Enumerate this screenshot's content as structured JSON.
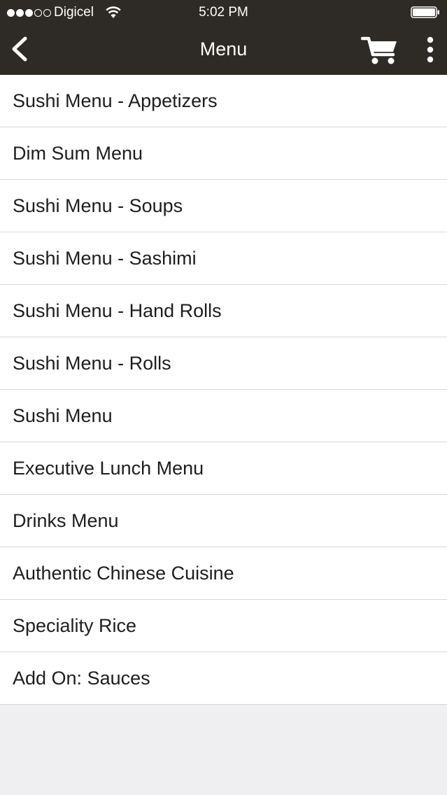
{
  "status_bar": {
    "carrier": "Digicel",
    "time": "5:02 PM",
    "signal_bars_filled": 3,
    "signal_bars_total": 5
  },
  "nav_bar": {
    "title": "Menu",
    "back_icon": "chevron-left-icon",
    "cart_icon": "cart-icon",
    "more_icon": "more-vertical-icon"
  },
  "colors": {
    "nav_background": "#2e2b26",
    "list_background": "#ffffff",
    "page_background": "#efeff1",
    "separator": "#d8d8d8",
    "text": "#1e1e1e"
  },
  "menu_items": [
    {
      "label": "Sushi Menu - Appetizers"
    },
    {
      "label": "Dim Sum Menu"
    },
    {
      "label": "Sushi Menu - Soups"
    },
    {
      "label": "Sushi Menu - Sashimi"
    },
    {
      "label": "Sushi Menu - Hand Rolls"
    },
    {
      "label": "Sushi Menu - Rolls"
    },
    {
      "label": "Sushi Menu"
    },
    {
      "label": "Executive Lunch Menu"
    },
    {
      "label": "Drinks Menu"
    },
    {
      "label": "Authentic Chinese Cuisine"
    },
    {
      "label": "Speciality Rice"
    },
    {
      "label": "Add On: Sauces"
    }
  ]
}
